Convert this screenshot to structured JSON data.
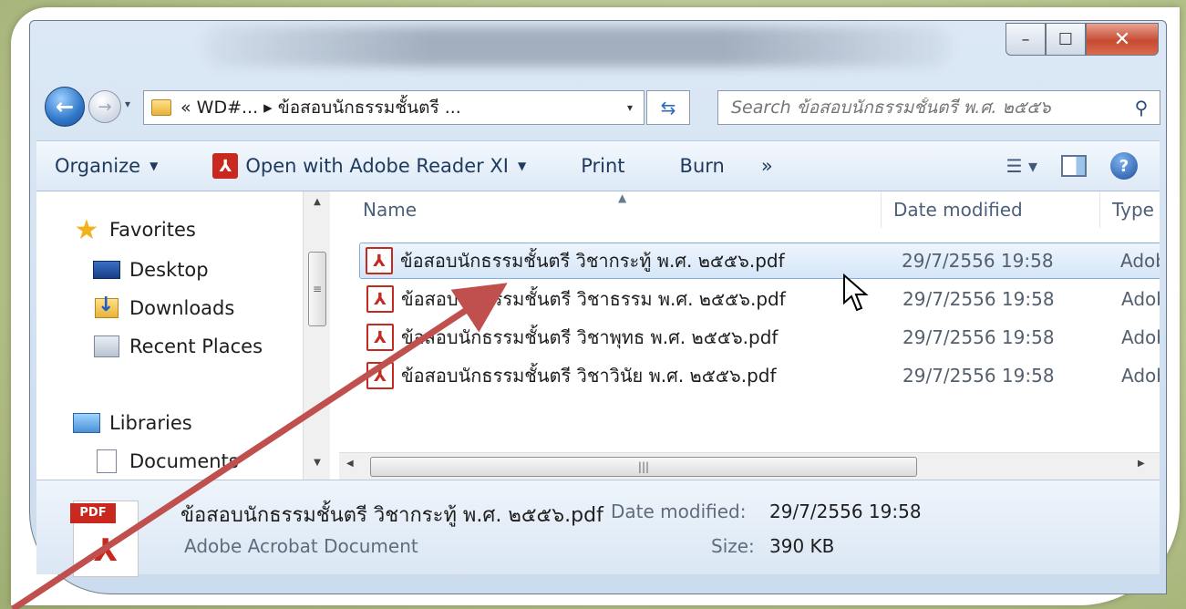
{
  "window": {
    "caption_buttons": {
      "minimize": "–",
      "maximize": "☐",
      "close": "✕"
    }
  },
  "nav": {
    "back_glyph": "←",
    "forward_glyph": "→",
    "history_glyph": "▾"
  },
  "address": {
    "path_text": "« WD#... ▸ ข้อสอบนักธรรมชั้นตรี ...",
    "dropdown_glyph": "▾",
    "refresh_glyph": "⇆"
  },
  "search": {
    "placeholder": "Search ข้อสอบนักธรรมชั้นตรี พ.ศ. ๒๕๕๖",
    "icon_glyph": "⚲"
  },
  "toolbar": {
    "organize": "Organize",
    "open_with": "Open with Adobe Reader XI",
    "print": "Print",
    "burn": "Burn",
    "more": "»",
    "caret": "▼",
    "help": "?"
  },
  "sidebar": {
    "favorites": "Favorites",
    "desktop": "Desktop",
    "downloads": "Downloads",
    "recent_places": "Recent Places",
    "libraries": "Libraries",
    "documents": "Documents"
  },
  "file_list": {
    "columns": {
      "name": "Name",
      "date_modified": "Date modified",
      "type": "Type"
    },
    "rows": [
      {
        "name": "ข้อสอบนักธรรมชั้นตรี วิชากระทู้ พ.ศ. ๒๕๕๖.pdf",
        "date": "29/7/2556 19:58",
        "type": "Adob"
      },
      {
        "name": "ข้อสอบนักธรรมชั้นตรี วิชาธรรม พ.ศ. ๒๕๕๖.pdf",
        "date": "29/7/2556 19:58",
        "type": "Adob"
      },
      {
        "name": "ข้อสอบนักธรรมชั้นตรี วิชาพุทธ พ.ศ. ๒๕๕๖.pdf",
        "date": "29/7/2556 19:58",
        "type": "Adob"
      },
      {
        "name": "ข้อสอบนักธรรมชั้นตรี วิชาวินัย พ.ศ. ๒๕๕๖.pdf",
        "date": "29/7/2556 19:58",
        "type": "Adob"
      }
    ]
  },
  "details": {
    "pdf_label": "PDF",
    "file_name": "ข้อสอบนักธรรมชั้นตรี วิชากระทู้ พ.ศ. ๒๕๕๖.pdf",
    "date_label": "Date modified:",
    "date_value": "29/7/2556 19:58",
    "file_type": "Adobe Acrobat Document",
    "size_label": "Size:",
    "size_value": "390 KB"
  },
  "colors": {
    "annotation_arrow": "#c0504d",
    "selection_border": "#84acdd",
    "pdf_red": "#c8281e"
  }
}
